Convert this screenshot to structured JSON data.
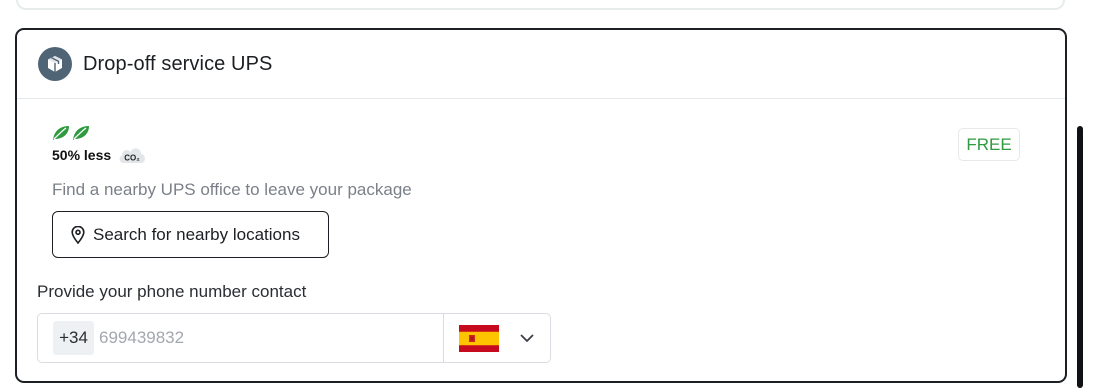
{
  "service": {
    "title": "Drop-off service UPS",
    "icon": "package-box-icon",
    "eco": {
      "icon": "leaf-icon",
      "leaf_count": 2,
      "leaf_color": "#2f9a3f",
      "label": "50% less",
      "co2_label": "CO₂"
    },
    "price": "FREE",
    "price_color": "#2f9a3f",
    "description": "Find a nearby UPS office to leave your package",
    "search_button": {
      "label": "Search for nearby locations",
      "icon": "map-pin-icon"
    }
  },
  "phone": {
    "label": "Provide your phone number contact",
    "prefix": "+34",
    "placeholder": "699439832",
    "value": "",
    "country_flag": "spain-flag-icon",
    "dropdown_icon": "chevron-down-icon"
  },
  "colors": {
    "accent_green": "#2f9a3f",
    "border_dark": "#1c1f23",
    "muted_text": "#7b8088"
  }
}
